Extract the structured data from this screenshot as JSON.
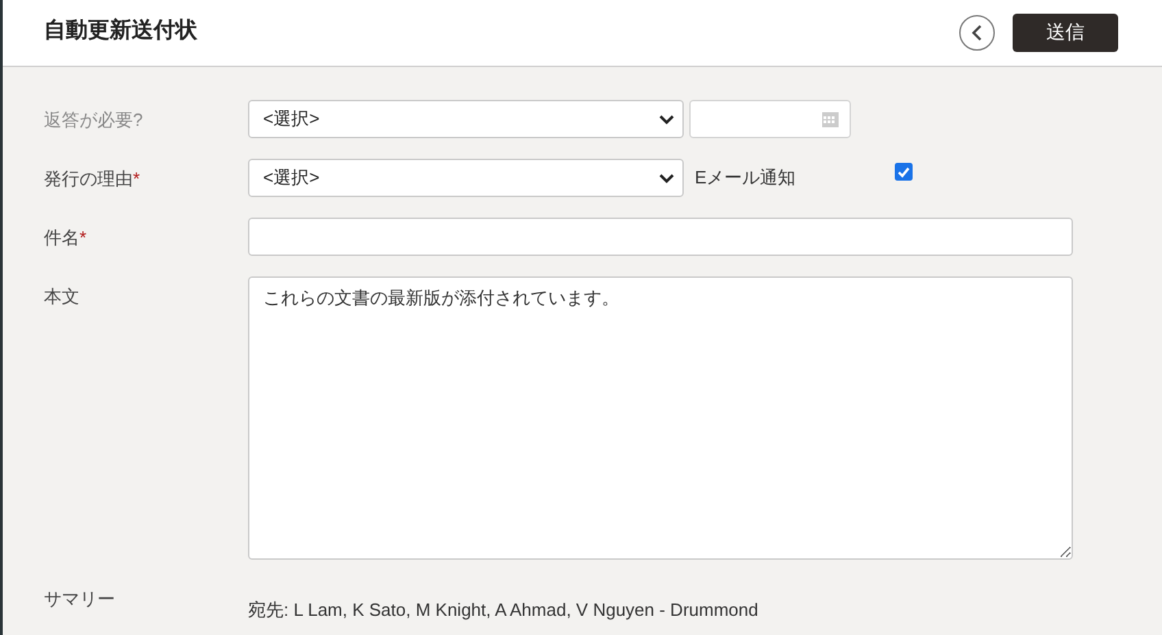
{
  "header": {
    "title": "自動更新送付状",
    "send_button": "送信"
  },
  "fields": [
    {
      "kind": "select_date",
      "label": "返答が必要?",
      "value": "<選択>"
    },
    {
      "kind": "select_check",
      "label": "発行の理由",
      "required_mark": "*",
      "value": "<選択>",
      "check_label": "Eメール通知",
      "checked": true
    },
    {
      "kind": "text",
      "label": "件名",
      "required_mark": "*"
    },
    {
      "kind": "textarea",
      "label": "本文",
      "value": "これらの文書の最新版が添付されています。"
    },
    {
      "kind": "summary",
      "label": "サマリー",
      "value": "宛先: L Lam, K Sato, M Knight, A Ahmad, V Nguyen - Drummond"
    }
  ]
}
